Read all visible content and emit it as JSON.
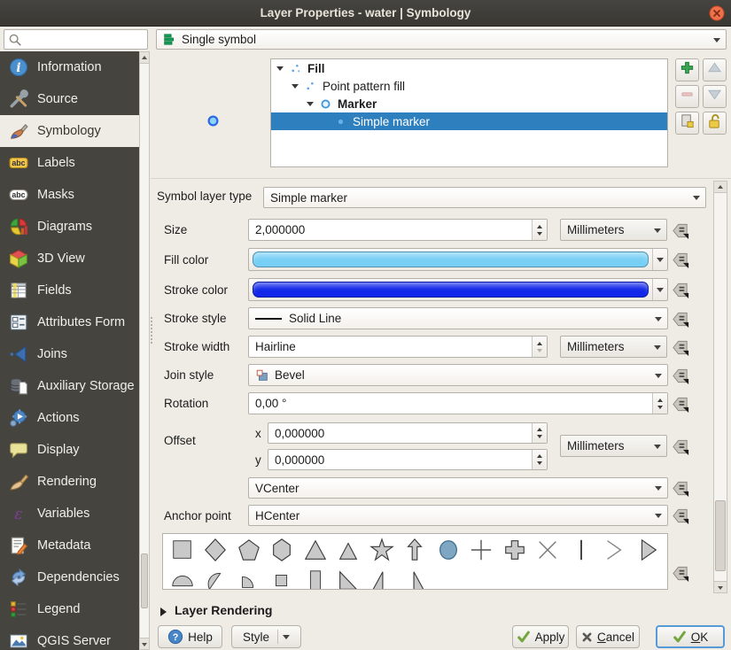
{
  "window": {
    "title": "Layer Properties - water | Symbology"
  },
  "search": {
    "placeholder": ""
  },
  "sidebar": {
    "items": [
      {
        "id": "information",
        "label": "Information",
        "icon": "info-icon",
        "active": false
      },
      {
        "id": "source",
        "label": "Source",
        "icon": "source-icon",
        "active": false
      },
      {
        "id": "symbology",
        "label": "Symbology",
        "icon": "symbology-icon",
        "active": true
      },
      {
        "id": "labels",
        "label": "Labels",
        "icon": "labels-icon",
        "active": false
      },
      {
        "id": "masks",
        "label": "Masks",
        "icon": "masks-icon",
        "active": false
      },
      {
        "id": "diagrams",
        "label": "Diagrams",
        "icon": "diagrams-icon",
        "active": false
      },
      {
        "id": "3d-view",
        "label": "3D View",
        "icon": "cube-3d-icon",
        "active": false
      },
      {
        "id": "fields",
        "label": "Fields",
        "icon": "fields-icon",
        "active": false
      },
      {
        "id": "attributes-form",
        "label": "Attributes Form",
        "icon": "attributes-form-icon",
        "active": false
      },
      {
        "id": "joins",
        "label": "Joins",
        "icon": "joins-icon",
        "active": false
      },
      {
        "id": "auxiliary-storage",
        "label": "Auxiliary Storage",
        "icon": "aux-storage-icon",
        "active": false
      },
      {
        "id": "actions",
        "label": "Actions",
        "icon": "actions-icon",
        "active": false
      },
      {
        "id": "display",
        "label": "Display",
        "icon": "display-icon",
        "active": false
      },
      {
        "id": "rendering",
        "label": "Rendering",
        "icon": "rendering-icon",
        "active": false
      },
      {
        "id": "variables",
        "label": "Variables",
        "icon": "variables-icon",
        "active": false
      },
      {
        "id": "metadata",
        "label": "Metadata",
        "icon": "metadata-icon",
        "active": false
      },
      {
        "id": "dependencies",
        "label": "Dependencies",
        "icon": "dependencies-icon",
        "active": false
      },
      {
        "id": "legend",
        "label": "Legend",
        "icon": "legend-icon",
        "active": false
      },
      {
        "id": "qgis-server",
        "label": "QGIS Server",
        "icon": "qgis-server-icon",
        "active": false
      }
    ]
  },
  "renderer": {
    "value": "Single symbol",
    "icon": "single-symbol-icon"
  },
  "symbol_tree": {
    "nodes": [
      {
        "id": "fill",
        "label": "Fill",
        "depth": 0,
        "bold": true,
        "icon": "fill-preview-icon",
        "expander": true,
        "selected": false
      },
      {
        "id": "point-pattern-fill",
        "label": "Point pattern fill",
        "depth": 1,
        "bold": false,
        "icon": "pattern-preview-icon",
        "expander": true,
        "selected": false
      },
      {
        "id": "marker",
        "label": "Marker",
        "depth": 2,
        "bold": true,
        "icon": "marker-ring-icon",
        "expander": true,
        "selected": false
      },
      {
        "id": "simple-marker",
        "label": "Simple marker",
        "depth": 3,
        "bold": false,
        "icon": "marker-dot-icon",
        "expander": false,
        "selected": true
      }
    ]
  },
  "properties": {
    "symbol_layer_type": {
      "label": "Symbol layer type",
      "value": "Simple marker"
    },
    "size": {
      "label": "Size",
      "value": "2,000000",
      "unit": "Millimeters"
    },
    "fill_color": {
      "label": "Fill color",
      "color": "#77cff5"
    },
    "stroke_color": {
      "label": "Stroke color",
      "color": "#1126e8"
    },
    "stroke_style": {
      "label": "Stroke style",
      "value": "Solid Line"
    },
    "stroke_width": {
      "label": "Stroke width",
      "value": "Hairline",
      "unit": "Millimeters"
    },
    "join_style": {
      "label": "Join style",
      "value": "Bevel"
    },
    "rotation": {
      "label": "Rotation",
      "value": "0,00 °"
    },
    "offset": {
      "label": "Offset",
      "x_label": "x",
      "x_value": "0,000000",
      "y_label": "y",
      "y_value": "0,000000",
      "unit": "Millimeters"
    },
    "anchor_point": {
      "label": "Anchor point",
      "vertical": "VCenter",
      "horizontal": "HCenter"
    }
  },
  "shape_gallery": {
    "selected": "circle",
    "row1": [
      "square",
      "diamond",
      "pentagon",
      "hexagon",
      "triangle",
      "equilateral-triangle",
      "star",
      "arrow",
      "circle",
      "cross",
      "cross-fill",
      "cross2",
      "line",
      "arrowhead",
      "filled-arrowhead"
    ],
    "row2": [
      "semi-circle",
      "third-circle",
      "quarter-circle",
      "quarter-square",
      "half-square",
      "diagonal-half-square",
      "right-half-triangle",
      "left-half-triangle"
    ]
  },
  "layer_rendering": {
    "label": "Layer Rendering"
  },
  "footer": {
    "help": "Help",
    "style": "Style",
    "apply": "Apply",
    "cancel": "Cancel",
    "cancel_accel": "C",
    "ok": "OK",
    "ok_accel": "O"
  },
  "colors": {
    "selection": "#2e7fbe",
    "sidebar_bg": "#45443f",
    "add_green": "#3aa553",
    "lock_yellow": "#ecca46"
  }
}
